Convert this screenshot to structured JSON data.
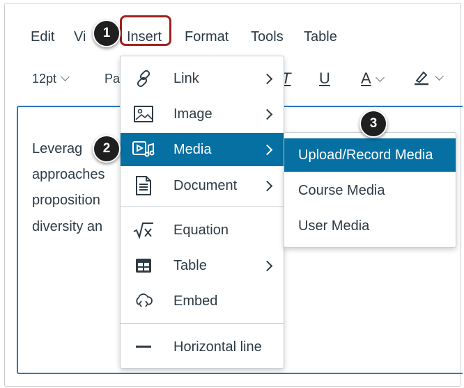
{
  "menubar": {
    "edit": "Edit",
    "view_partial": "Vi",
    "insert": "Insert",
    "format": "Format",
    "tools": "Tools",
    "table": "Table"
  },
  "toolbar": {
    "font_size": "12pt",
    "paragraph_partial": "Pa",
    "italic": "T",
    "underline": "U",
    "text_color": "A"
  },
  "editor": {
    "lines": [
      "Leverag",
      "approaches",
      "proposition",
      "diversity an"
    ]
  },
  "insert_menu": {
    "items": [
      {
        "label": "Link",
        "icon": "link-icon",
        "submenu": true
      },
      {
        "label": "Image",
        "icon": "image-icon",
        "submenu": true
      },
      {
        "label": "Media",
        "icon": "media-icon",
        "submenu": true,
        "active": true
      },
      {
        "label": "Document",
        "icon": "document-icon",
        "submenu": true
      },
      {
        "label": "Equation",
        "icon": "equation-icon",
        "submenu": false
      },
      {
        "label": "Table",
        "icon": "table-icon",
        "submenu": true
      },
      {
        "label": "Embed",
        "icon": "embed-icon",
        "submenu": false
      },
      {
        "label": "Horizontal line",
        "icon": "horizontal-line-icon",
        "submenu": false
      }
    ]
  },
  "media_submenu": {
    "items": [
      {
        "label": "Upload/Record Media",
        "active": true
      },
      {
        "label": "Course Media"
      },
      {
        "label": "User Media"
      }
    ]
  },
  "callouts": [
    "1",
    "2",
    "3"
  ],
  "colors": {
    "accent": "#0770a3",
    "highlight_border": "#a0211c",
    "editor_focus": "#2b7abc",
    "callout_bg": "#1f1f1f"
  }
}
